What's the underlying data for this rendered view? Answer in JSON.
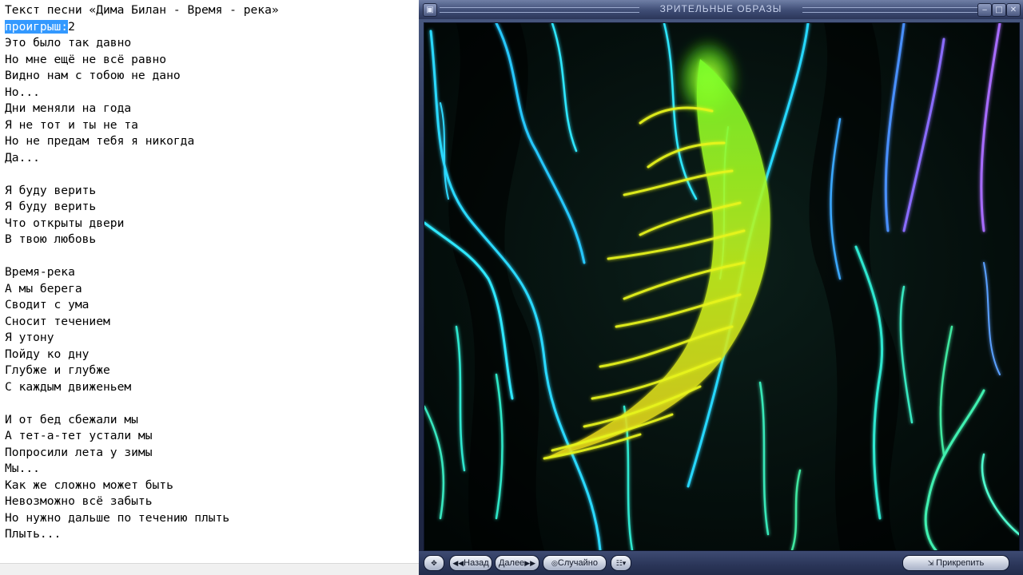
{
  "editor": {
    "selection": "проигрыш:",
    "lines": [
      "Текст песни «Дима Билан - Время - река»",
      "проигрыш:2",
      "Это было так давно",
      "Но мне ещё не всё равно",
      "Видно нам с тобою не дано",
      "Но...",
      "Дни меняли на года",
      "Я не тот и ты не та",
      "Но не предам тебя я никогда",
      "Да...",
      "",
      "Я буду верить",
      "Я буду верить",
      "Что открыты двери",
      "В твою любовь",
      "",
      "Время-река",
      "А мы берега",
      "Сводит с ума",
      "Сносит течением",
      "Я утону",
      "Пойду ко дну",
      "Глубже и глубже",
      "С каждым движеньем",
      "",
      "И от бед сбежали мы",
      "А тет-а-тет устали мы",
      "Попросили лета у зимы",
      "Мы...",
      "Как же сложно может быть",
      "Невозможно всё забыть",
      "Но нужно дальше по течению плыть",
      "Плыть..."
    ]
  },
  "visualizer": {
    "title": "ЗРИТЕЛЬНЫЕ ОБРАЗЫ",
    "titlebar_icons": [
      "restore-icon",
      "minimize-icon",
      "maximize-icon",
      "close-icon"
    ],
    "controls": {
      "move_icon": "move-icon",
      "back_label": "Назад",
      "next_label": "Далее",
      "random_label": "Случайно",
      "menu_icon": "menu-icon",
      "pin_label": "Прикрепить"
    },
    "colors": {
      "frame": "#2b3659",
      "fern_glow": "#a8ff2a",
      "fern_yellow": "#e6f01e",
      "streak_cyan": "#2fe8ff",
      "streak_green": "#3fe8a0",
      "streak_violet": "#9a6cff"
    }
  }
}
